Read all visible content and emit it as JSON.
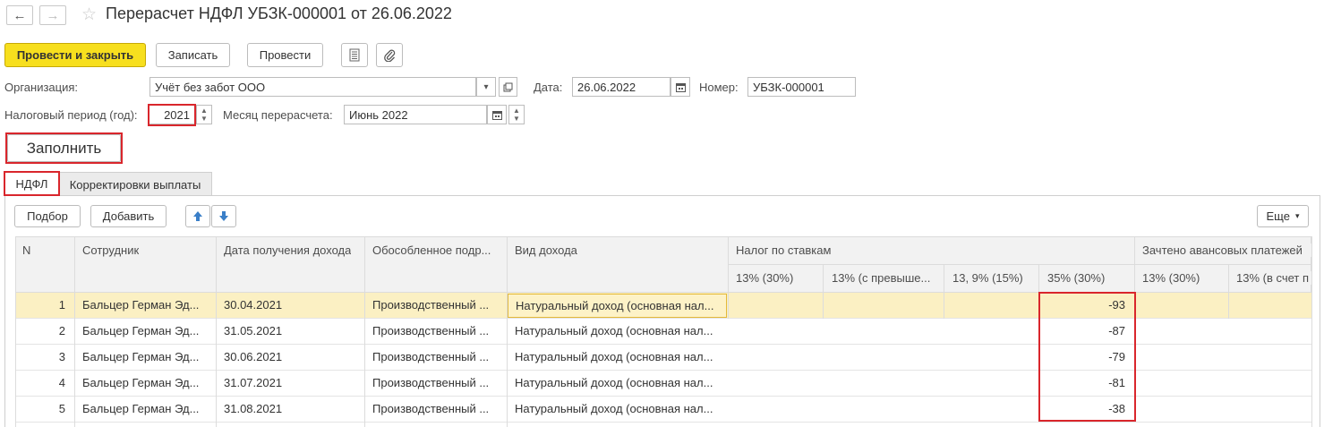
{
  "window": {
    "title": "Перерасчет НДФЛ УБЗК-000001 от 26.06.2022",
    "back_icon": "arrow-left-icon",
    "forward_icon": "arrow-right-icon",
    "favorite_icon": "star-icon"
  },
  "toolbar": {
    "post_close_label": "Провести и закрыть",
    "save_label": "Записать",
    "post_label": "Провести",
    "report_icon": "document-icon",
    "attach_icon": "paperclip-icon"
  },
  "form": {
    "org_label": "Организация:",
    "org_value": "Учёт без забот ООО",
    "date_label": "Дата:",
    "date_value": "26.06.2022",
    "number_label": "Номер:",
    "number_value": "УБЗК-000001",
    "tax_period_label": "Налоговый период (год):",
    "tax_period_value": "2021",
    "recalc_month_label": "Месяц перерасчета:",
    "recalc_month_value": "Июнь 2022",
    "fill_label": "Заполнить"
  },
  "tabs": [
    {
      "label": "НДФЛ",
      "active": true
    },
    {
      "label": "Корректировки выплаты",
      "active": false
    }
  ],
  "table_toolbar": {
    "select_label": "Подбор",
    "add_label": "Добавить",
    "more_label": "Еще"
  },
  "table": {
    "headers": {
      "n": "N",
      "employee": "Сотрудник",
      "income_date": "Дата получения дохода",
      "division": "Обособленное подр...",
      "income_type": "Вид дохода",
      "tax_by_rates": "Налог по ставкам",
      "credited_advances": "Зачтено авансовых платежей",
      "rate_13_30": "13% (30%)",
      "rate_13_excess": "13% (с превыше...",
      "rate_13_9_15": "13, 9% (15%)",
      "rate_35_30": "35% (30%)",
      "adv_13_30": "13% (30%)",
      "adv_13_account": "13% (в счет п"
    },
    "rows": [
      {
        "n": "1",
        "employee": "Бальцер Герман Эд...",
        "date": "30.04.2021",
        "division": "Производственный ...",
        "income_type": "Натуральный доход (основная нал...",
        "rate_35": "-93"
      },
      {
        "n": "2",
        "employee": "Бальцер Герман Эд...",
        "date": "31.05.2021",
        "division": "Производственный ...",
        "income_type": "Натуральный доход (основная нал...",
        "rate_35": "-87"
      },
      {
        "n": "3",
        "employee": "Бальцер Герман Эд...",
        "date": "30.06.2021",
        "division": "Производственный ...",
        "income_type": "Натуральный доход (основная нал...",
        "rate_35": "-79"
      },
      {
        "n": "4",
        "employee": "Бальцер Герман Эд...",
        "date": "31.07.2021",
        "division": "Производственный ...",
        "income_type": "Натуральный доход (основная нал...",
        "rate_35": "-81"
      },
      {
        "n": "5",
        "employee": "Бальцер Герман Эд...",
        "date": "31.08.2021",
        "division": "Производственный ...",
        "income_type": "Натуральный доход (основная нал...",
        "rate_35": "-38"
      }
    ]
  },
  "colors": {
    "accent_yellow": "#f7df1e",
    "highlight_red": "#d9262c",
    "selected_row": "#fbf0c3",
    "arrow_blue": "#3a7fc8"
  }
}
